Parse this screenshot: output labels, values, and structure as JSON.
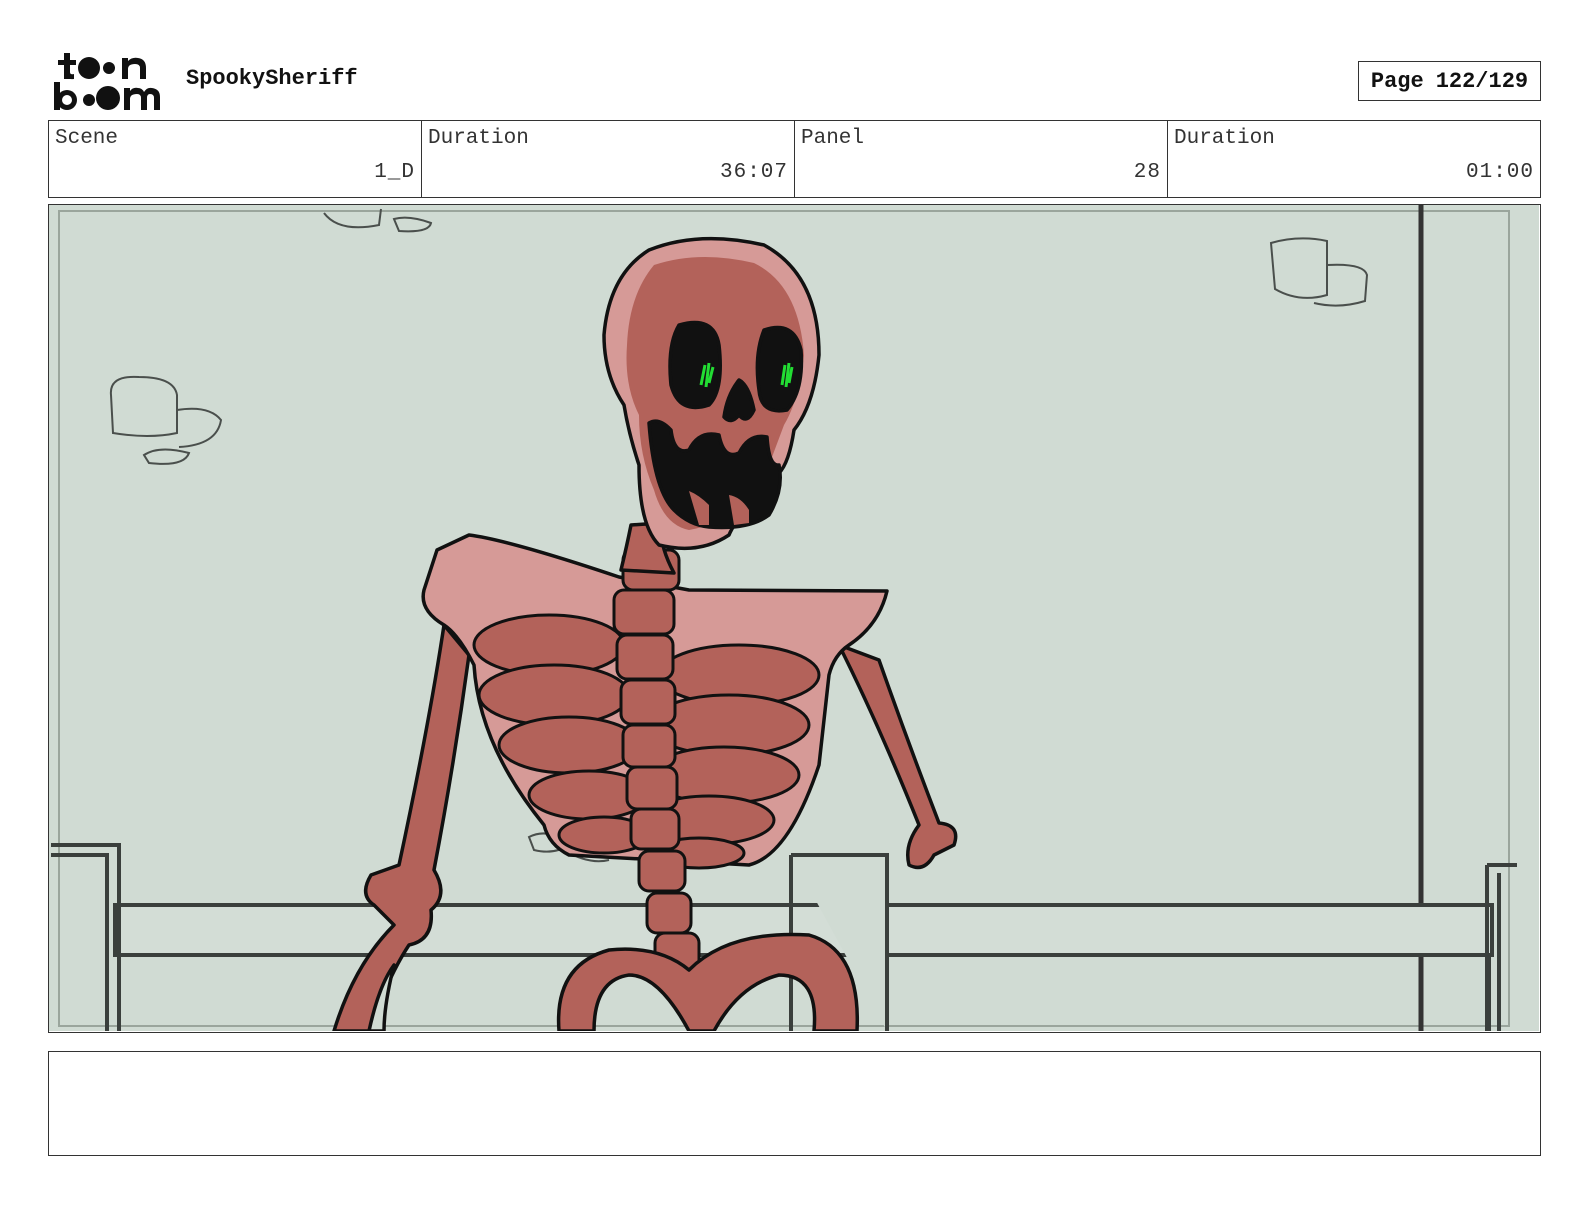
{
  "header": {
    "logo_line1": "toon",
    "logo_line2": "boom",
    "project_title": "SpookySheriff",
    "page_label": "Page",
    "page_value": "122/129"
  },
  "info": {
    "scene_label": "Scene",
    "scene_value": "1_D",
    "scene_duration_label": "Duration",
    "scene_duration_value": "36:07",
    "panel_label": "Panel",
    "panel_value": "28",
    "panel_duration_label": "Duration",
    "panel_duration_value": "01:00"
  },
  "panel": {
    "background_color": "#d0dbd3",
    "skeleton_color": "#b3625a",
    "skeleton_highlight": "#d69a97",
    "eye_glow_color": "#22dd33"
  },
  "notes": {
    "text": ""
  }
}
